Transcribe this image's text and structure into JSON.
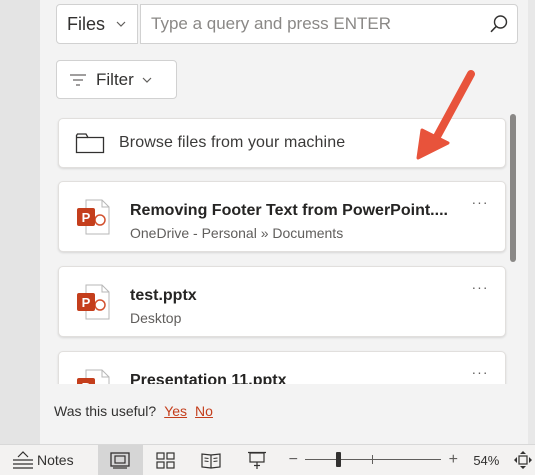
{
  "search": {
    "scope_label": "Files",
    "placeholder": "Type a query and press ENTER",
    "value": ""
  },
  "filter": {
    "label": "Filter"
  },
  "browse": {
    "label": "Browse files from your machine"
  },
  "files": [
    {
      "name": "Removing Footer Text from PowerPoint....",
      "location": "OneDrive - Personal » Documents",
      "icon": "powerpoint-file-icon",
      "more": "···"
    },
    {
      "name": "test.pptx",
      "location": "Desktop",
      "icon": "powerpoint-file-icon",
      "more": "···"
    },
    {
      "name": "Presentation 11.pptx",
      "location": "",
      "icon": "powerpoint-file-icon",
      "more": "···"
    }
  ],
  "feedback": {
    "question": "Was this useful?",
    "yes": "Yes",
    "no": "No"
  },
  "status_bar": {
    "notes_label": "Notes",
    "zoom_minus": "−",
    "zoom_plus": "+",
    "zoom_percent": "54%",
    "zoom_level": 54
  },
  "colors": {
    "accent": "#c43e1c",
    "arrow": "#e8533b",
    "ppt_orange": "#c43e1c"
  },
  "icons": {
    "search": "search-icon",
    "folder": "folder-icon",
    "filter": "filter-icon",
    "chevron": "chevron-down-icon",
    "notes": "notes-icon",
    "normal_view": "normal-view-icon",
    "slide_sorter": "slide-sorter-icon",
    "reading_view": "reading-view-icon",
    "presenter": "slide-show-icon",
    "fit": "fit-to-window-icon"
  }
}
